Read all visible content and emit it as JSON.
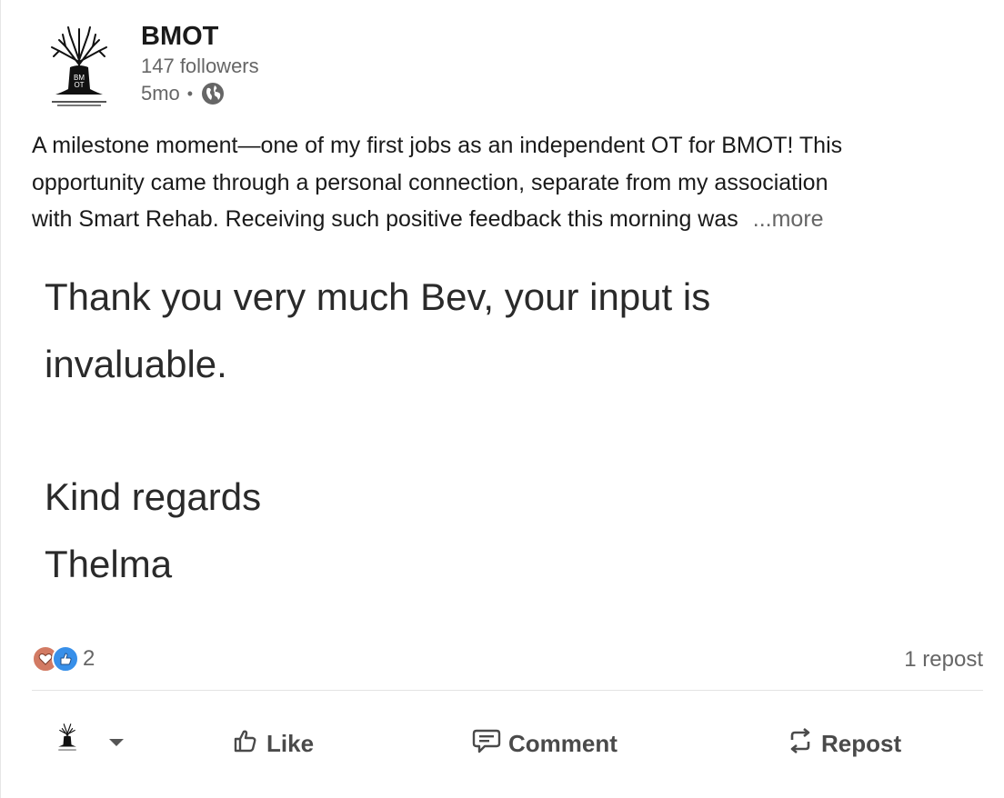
{
  "post": {
    "author": "BMOT",
    "followers": "147 followers",
    "age": "5mo",
    "separator": "•",
    "visibility_icon": "globe-icon",
    "logo_text": "BM OT",
    "text_lines": [
      "A milestone moment—one of my first jobs as an independent OT for BMOT! This",
      "opportunity came through a personal connection, separate from my association",
      "with Smart Rehab. Receiving such positive feedback this morning was"
    ],
    "more_label": "...more"
  },
  "image": {
    "lines": [
      "Thank you very much Bev, your input is",
      "invaluable.",
      "Kind regards",
      "Thelma"
    ]
  },
  "social": {
    "reaction_icons": [
      "love-icon",
      "like-icon"
    ],
    "reaction_count": "2",
    "reposts": "1 repost"
  },
  "actions": {
    "like": "Like",
    "comment": "Comment",
    "repost": "Repost"
  },
  "colors": {
    "love": "#d27a63",
    "like": "#378fe9",
    "text": "#1a1a1a",
    "muted": "#666666"
  }
}
